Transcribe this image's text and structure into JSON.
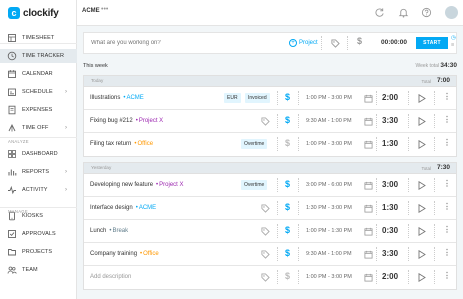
{
  "app": {
    "logo_mark": "c",
    "logo_text": "clockify"
  },
  "sidebar": {
    "items": [
      {
        "label": "TIMESHEET",
        "icon": "timesheet-icon"
      },
      {
        "label": "TIME TRACKER",
        "icon": "clock-icon",
        "active": true
      },
      {
        "label": "CALENDAR",
        "icon": "calendar-icon"
      },
      {
        "label": "SCHEDULE",
        "icon": "schedule-icon",
        "chevron": "›"
      },
      {
        "label": "EXPENSES",
        "icon": "expenses-icon"
      },
      {
        "label": "TIME OFF",
        "icon": "time-off-icon",
        "chevron": "›"
      },
      {
        "label": "DASHBOARD",
        "icon": "dashboard-icon"
      },
      {
        "label": "REPORTS",
        "icon": "reports-icon",
        "chevron": "›"
      },
      {
        "label": "ACTIVITY",
        "icon": "activity-icon",
        "chevron": "›"
      },
      {
        "label": "KIOSKS",
        "icon": "kiosk-icon"
      },
      {
        "label": "APPROVALS",
        "icon": "approvals-icon"
      },
      {
        "label": "PROJECTS",
        "icon": "projects-icon"
      },
      {
        "label": "TEAM",
        "icon": "team-icon"
      }
    ],
    "section_analyze": "ANALYZE",
    "section_manage": "MANAGE"
  },
  "topbar": {
    "workspace": "ACME",
    "more": "•••"
  },
  "timer": {
    "placeholder": "What are you working on?",
    "project_label": "Project",
    "time": "00:00:00",
    "start_label": "START"
  },
  "week": {
    "label": "This week",
    "total_label": "Week total",
    "total": "34:30"
  },
  "days": [
    {
      "label": "Today",
      "total_label": "Total",
      "total": "7:00",
      "entries": [
        {
          "desc": "Illustrations",
          "project": "ACME",
          "project_color": "#03a9f4",
          "tags": [
            "EUR",
            "Invoiced"
          ],
          "billable": true,
          "range": "1:00 PM - 3:00 PM",
          "duration": "2:00"
        },
        {
          "desc": "Fixing bug #212",
          "project": "Project X",
          "project_color": "#9c27b0",
          "tags": [],
          "billable": true,
          "range": "9:30 AM - 1:00 PM",
          "duration": "3:30"
        },
        {
          "desc": "Filing tax return",
          "project": "Office",
          "project_color": "#ff9800",
          "tags": [
            "Overtime"
          ],
          "billable": false,
          "range": "1:00 PM - 3:00 PM",
          "duration": "1:30"
        }
      ]
    },
    {
      "label": "Yesterday",
      "total_label": "Total",
      "total": "7:30",
      "entries": [
        {
          "desc": "Developing new feature",
          "project": "Project X",
          "project_color": "#9c27b0",
          "tags": [
            "Overtime"
          ],
          "billable": true,
          "range": "3:00 PM - 6:00 PM",
          "duration": "3:00"
        },
        {
          "desc": "Interface design",
          "project": "ACME",
          "project_color": "#03a9f4",
          "tags": [],
          "billable": true,
          "range": "1:30 PM - 3:00 PM",
          "duration": "1:30"
        },
        {
          "desc": "Lunch",
          "project": "Break",
          "project_color": "#607d8b",
          "tags": [],
          "billable": true,
          "range": "1:00 PM - 1:30 PM",
          "duration": "0:30"
        },
        {
          "desc": "Company training",
          "project": "Office",
          "project_color": "#ff9800",
          "tags": [],
          "billable": true,
          "range": "9:30 AM - 1:00 PM",
          "duration": "3:30"
        },
        {
          "desc": "Add description",
          "project": "",
          "project_color": "#999999",
          "tags": [],
          "billable": false,
          "placeholder": true,
          "range": "1:00 PM - 3:00 PM",
          "duration": "2:00"
        }
      ]
    }
  ],
  "colors": {
    "accent": "#03a9f4",
    "billable_off": "#bbbbbb",
    "active_nav": "#e4eaee",
    "content_bg": "#f2f6f8"
  }
}
